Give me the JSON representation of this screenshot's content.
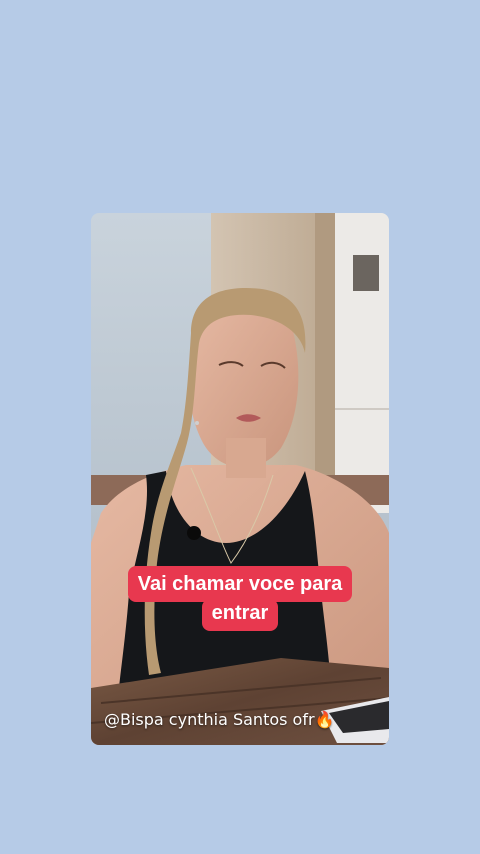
{
  "colors": {
    "background": "#b6cbe7",
    "caption_bg": "#e8384f",
    "caption_text": "#ffffff"
  },
  "story": {
    "caption_lines": [
      "Vai chamar voce para",
      "entrar"
    ],
    "mention_text": "@Bispa cynthia Santos ofr🔥"
  }
}
